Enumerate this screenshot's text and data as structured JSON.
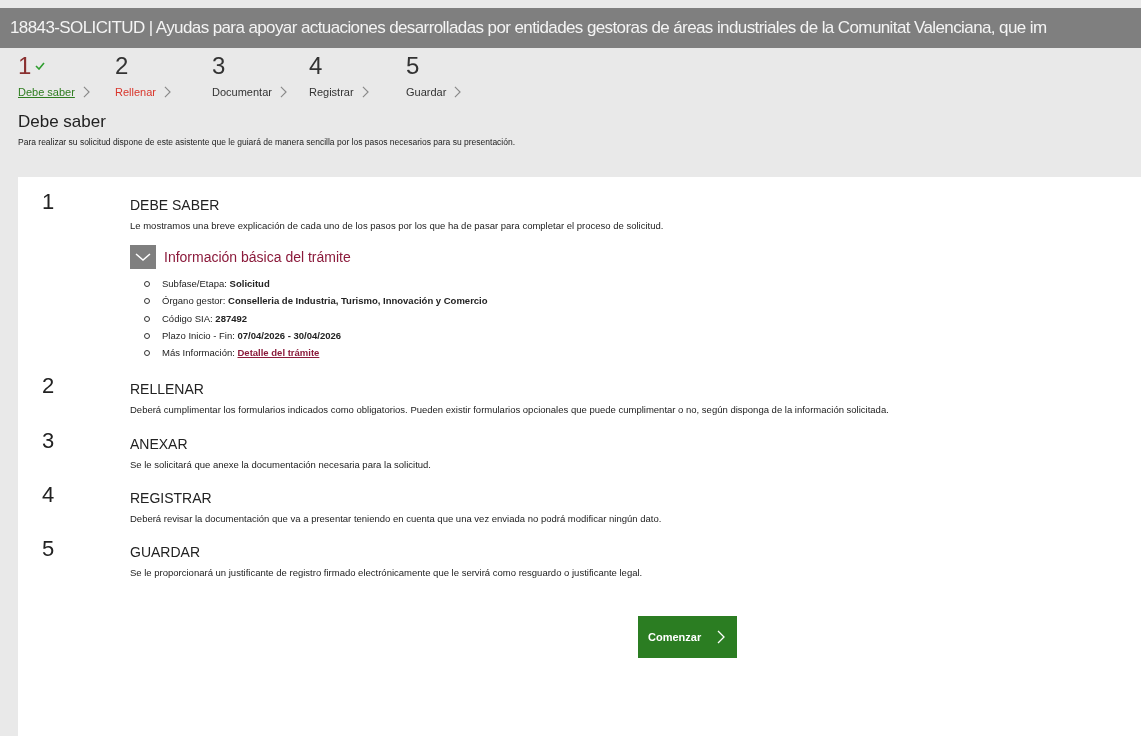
{
  "header": {
    "title": "18843-SOLICITUD | Ayudas para apoyar actuaciones desarrolladas por entidades gestoras de áreas industriales de la Comunitat Valenciana, que im"
  },
  "steps": [
    {
      "number": "1",
      "label": "Debe saber",
      "completed": true,
      "selected": false
    },
    {
      "number": "2",
      "label": "Rellenar",
      "completed": false,
      "selected": true
    },
    {
      "number": "3",
      "label": "Documentar",
      "completed": false,
      "selected": false
    },
    {
      "number": "4",
      "label": "Registrar",
      "completed": false,
      "selected": false
    },
    {
      "number": "5",
      "label": "Guardar",
      "completed": false,
      "selected": false
    }
  ],
  "page_heading": "Debe saber",
  "page_intro": "Para realizar su solicitud dispone de este asistente que le guiará de manera sencilla por los pasos necesarios para su presentación.",
  "sections": [
    {
      "number": "1",
      "title": "DEBE SABER",
      "text": "Le mostramos una breve explicación de cada uno de los pasos por los que ha de pasar para completar el proceso de solicitud.",
      "info": {
        "title": "Información básica del trámite",
        "expanded": true,
        "items": [
          {
            "label": "Subfase/Etapa:",
            "value": "Solicitud",
            "kind": "text"
          },
          {
            "label": "Órgano gestor:",
            "value": "Conselleria de Industria, Turismo, Innovación y Comercio",
            "kind": "text"
          },
          {
            "label": "Código SIA:",
            "value": "287492",
            "kind": "text"
          },
          {
            "label": "Plazo Inicio - Fin:",
            "value": "07/04/2026 - 30/04/2026",
            "kind": "text"
          },
          {
            "label": "Más Información:",
            "value": "Detalle del trámite",
            "kind": "link"
          }
        ]
      }
    },
    {
      "number": "2",
      "title": "RELLENAR",
      "text": "Deberá cumplimentar los formularios indicados como obligatorios. Pueden existir formularios opcionales que puede cumplimentar o no, según disponga de la información solicitada."
    },
    {
      "number": "3",
      "title": "ANEXAR",
      "text": "Se le solicitará que anexe la documentación necesaria para la solicitud."
    },
    {
      "number": "4",
      "title": "REGISTRAR",
      "text": "Deberá revisar la documentación que va a presentar teniendo en cuenta que una vez enviada no podrá modificar ningún dato."
    },
    {
      "number": "5",
      "title": "GUARDAR",
      "text": "Se le proporcionará un justificante de registro firmado electrónicamente que le servirá como resguardo o justificante legal."
    }
  ],
  "start_button": {
    "label": "Comenzar"
  }
}
